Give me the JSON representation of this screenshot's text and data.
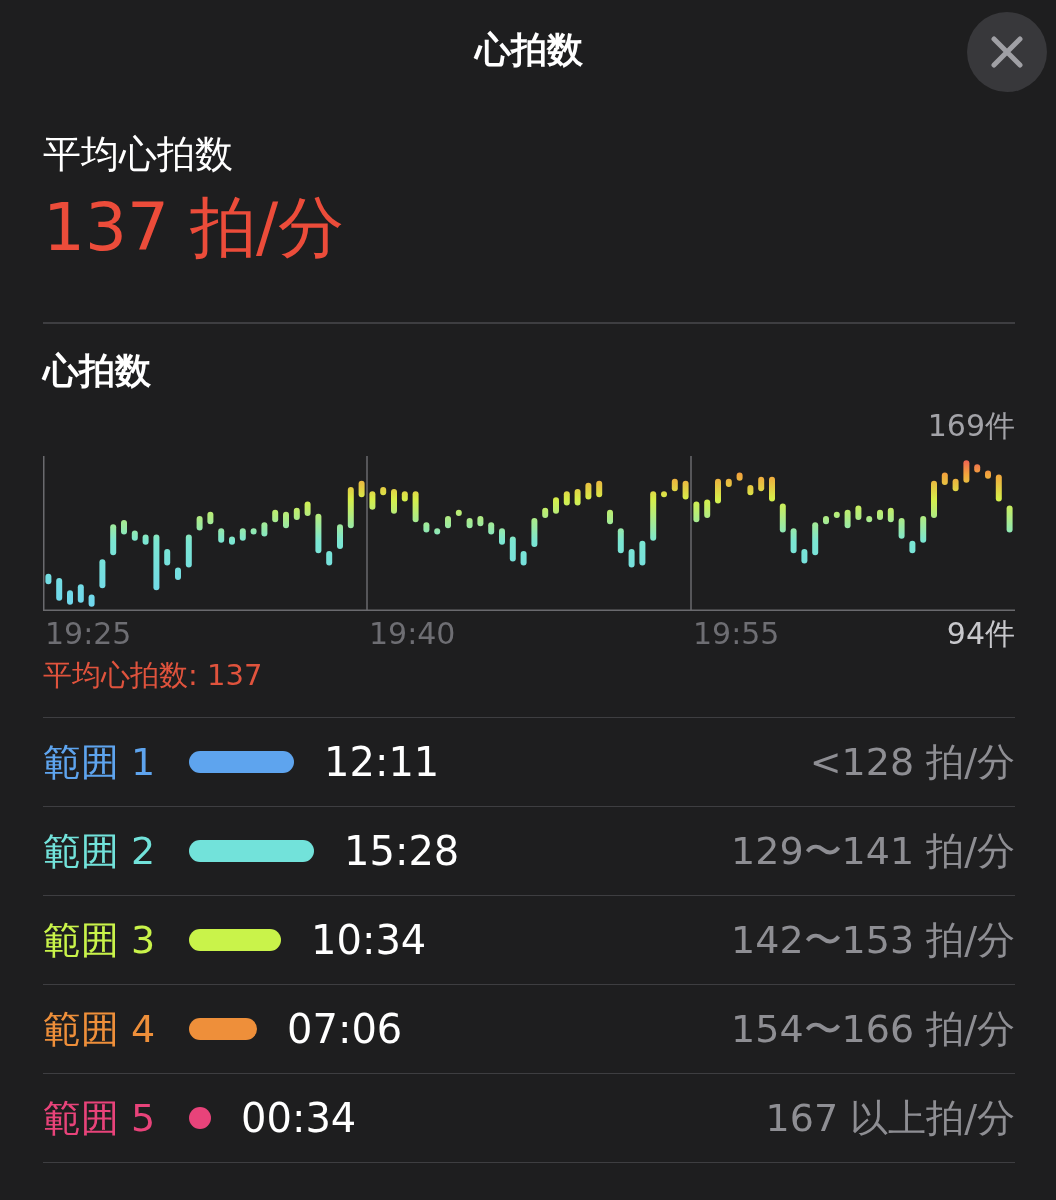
{
  "header": {
    "title": "心拍数"
  },
  "summary": {
    "label": "平均心拍数",
    "value": "137 拍/分"
  },
  "chart_section": {
    "title": "心拍数",
    "top_label": "169件",
    "time_labels": [
      "19:25",
      "19:40",
      "19:55"
    ],
    "bottom_label": "94件",
    "average_label": "平均心拍数: 137"
  },
  "zones": [
    {
      "label": "範囲 1",
      "color": "#5ea4ee",
      "duration": "12:11",
      "range": "<128 拍/分"
    },
    {
      "label": "範囲 2",
      "color": "#72e2da",
      "duration": "15:28",
      "range": "129〜141 拍/分"
    },
    {
      "label": "範囲 3",
      "color": "#c9f34a",
      "duration": "10:34",
      "range": "142〜153 拍/分"
    },
    {
      "label": "範囲 4",
      "color": "#ee8f3a",
      "duration": "07:06",
      "range": "154〜166 拍/分"
    },
    {
      "label": "範囲 5",
      "color": "#e8437a",
      "duration": "00:34",
      "range": "167 以上拍/分"
    }
  ]
}
